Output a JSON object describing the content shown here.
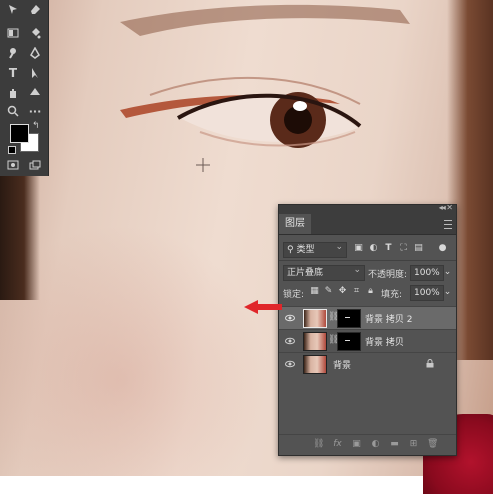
{
  "layers_panel": {
    "tab_title": "图层",
    "filter": {
      "kind_label": "类型"
    },
    "blend_mode": "正片叠底",
    "opacity_label": "不透明度:",
    "opacity_value": "100%",
    "lock_label": "锁定:",
    "fill_label": "填充:",
    "fill_value": "100%",
    "layers": [
      {
        "name": "背景 拷贝 2",
        "selected": true,
        "has_mask": true
      },
      {
        "name": "背景 拷贝",
        "selected": false,
        "has_mask": true
      },
      {
        "name": "背景",
        "selected": false,
        "has_mask": false,
        "locked": true
      }
    ]
  },
  "colors": {
    "panel_bg": "#535353",
    "selected_row": "#6a6a6a",
    "pointer_arrow": "#e0262a",
    "foreground_swatch": "#000000",
    "background_swatch": "#ffffff"
  },
  "tools": [
    "move-icon",
    "eraser-icon",
    "gradient-icon",
    "paint-bucket-icon",
    "dodge-icon",
    "pen-icon",
    "type-icon",
    "path-select-icon",
    "hand-icon",
    "custom-shape-icon",
    "zoom-icon",
    "more-icon"
  ]
}
